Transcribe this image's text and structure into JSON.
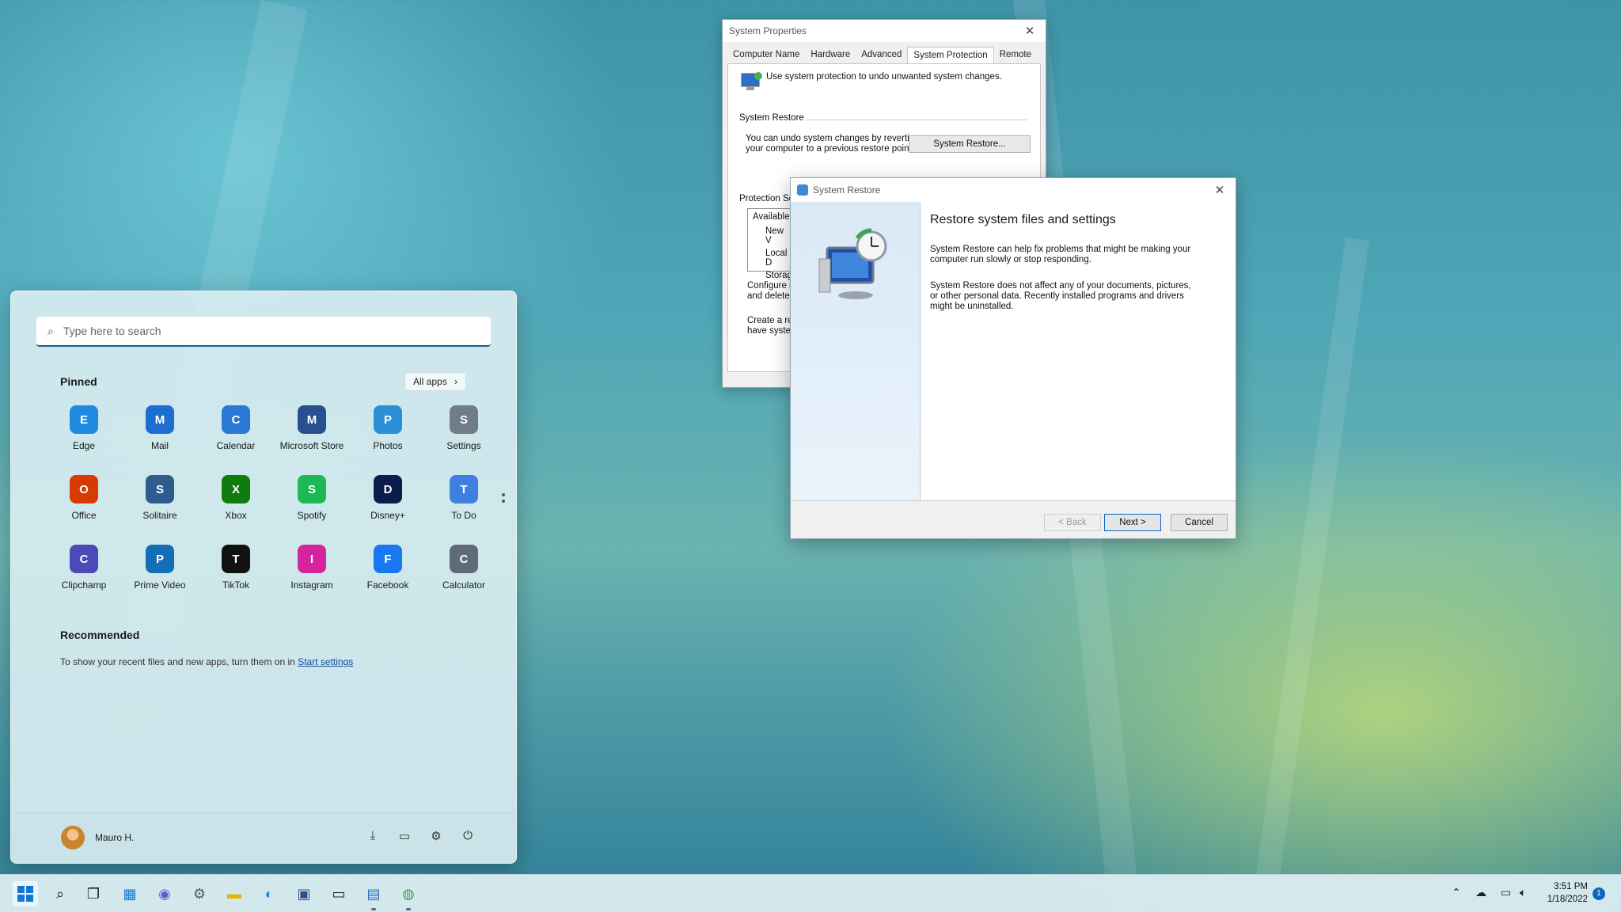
{
  "system_properties": {
    "title": "System Properties",
    "tabs": [
      "Computer Name",
      "Hardware",
      "Advanced",
      "System Protection",
      "Remote"
    ],
    "active_tab": "System Protection",
    "intro": "Use system protection to undo unwanted system changes.",
    "restore_group": "System Restore",
    "restore_text_1": "You can undo system changes by reverting",
    "restore_text_2": "your computer to a previous restore point.",
    "restore_button": "System Restore...",
    "protection_group": "Protection Set",
    "list_header": "Available",
    "list_items": [
      "New V",
      "Local D",
      "Storag"
    ],
    "configure_1": "Configure re",
    "configure_2": "and delete r",
    "create_1": "Create a res",
    "create_2": "have system"
  },
  "system_restore": {
    "title": "System Restore",
    "heading": "Restore system files and settings",
    "para_1": "System Restore can help fix problems that might be making your computer run slowly or stop responding.",
    "para_2": "System Restore does not affect any of your documents, pictures, or other personal data. Recently installed programs and drivers might be uninstalled.",
    "back_button": "< Back",
    "next_button": "Next >",
    "cancel_button": "Cancel"
  },
  "start_menu": {
    "search_placeholder": "Type here to search",
    "pinned_label": "Pinned",
    "all_apps_label": "All apps",
    "apps": [
      {
        "label": "Edge",
        "icon": "edge-icon",
        "color": "#1f8be0"
      },
      {
        "label": "Mail",
        "icon": "mail-icon",
        "color": "#1c6fd1"
      },
      {
        "label": "Calendar",
        "icon": "calendar-icon",
        "color": "#2b78d4"
      },
      {
        "label": "Microsoft Store",
        "icon": "store-icon",
        "color": "#2a4f8f"
      },
      {
        "label": "Photos",
        "icon": "photos-icon",
        "color": "#2c8fd6"
      },
      {
        "label": "Settings",
        "icon": "gear-icon",
        "color": "#6d7d8a"
      },
      {
        "label": "Office",
        "icon": "office-icon",
        "color": "#d83b01"
      },
      {
        "label": "Solitaire",
        "icon": "solitaire-icon",
        "color": "#2f5c8f"
      },
      {
        "label": "Xbox",
        "icon": "xbox-icon",
        "color": "#107c10"
      },
      {
        "label": "Spotify",
        "icon": "spotify-icon",
        "color": "#1db954"
      },
      {
        "label": "Disney+",
        "icon": "disney-icon",
        "color": "#0b1d4d"
      },
      {
        "label": "To Do",
        "icon": "todo-icon",
        "color": "#3f7fe0"
      },
      {
        "label": "Clipchamp",
        "icon": "clipchamp-icon",
        "color": "#4a4ab8"
      },
      {
        "label": "Prime Video",
        "icon": "prime-video-icon",
        "color": "#146eb4"
      },
      {
        "label": "TikTok",
        "icon": "tiktok-icon",
        "color": "#111111"
      },
      {
        "label": "Instagram",
        "icon": "instagram-icon",
        "color": "#d6249f"
      },
      {
        "label": "Facebook",
        "icon": "facebook-icon",
        "color": "#1877f2"
      },
      {
        "label": "Calculator",
        "icon": "calculator-icon",
        "color": "#5f6b78"
      }
    ],
    "recommended_label": "Recommended",
    "recommended_text": "To show your recent files and new apps, turn them on in",
    "recommended_link": "Start settings",
    "user_name": "Mauro H."
  },
  "taskbar": {
    "time": "3:51 PM",
    "date": "1/18/2022",
    "notification_count": "1"
  }
}
